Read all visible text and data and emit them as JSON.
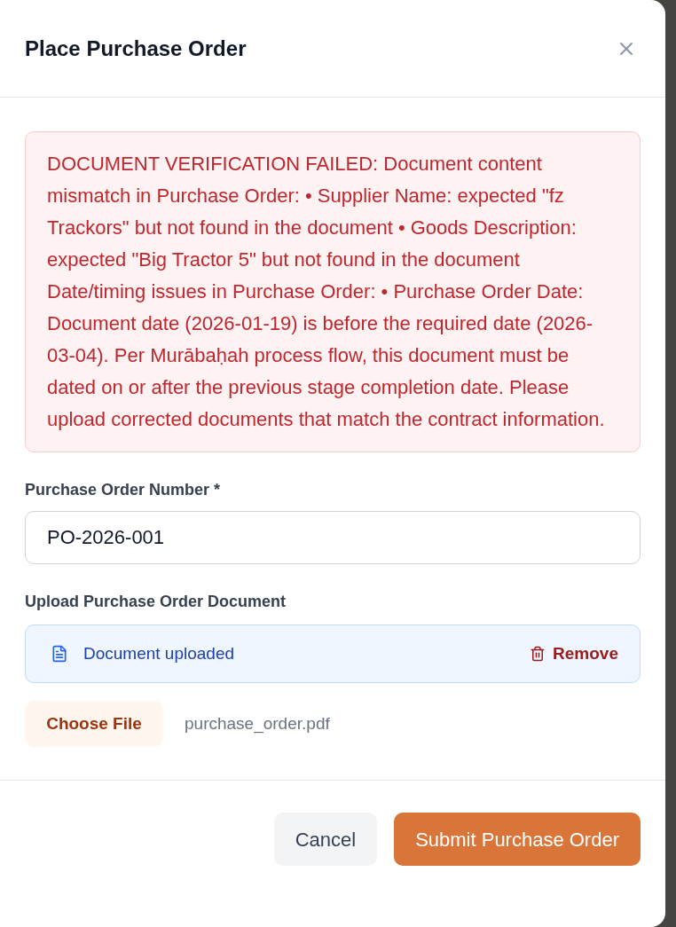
{
  "dialog": {
    "title": "Place Purchase Order"
  },
  "alert": {
    "kind": "error",
    "message": "DOCUMENT VERIFICATION FAILED: Document content mismatch in Purchase Order: • Supplier Name: expected \"fz Trackors\" but not found in the document • Goods Description: expected \"Big Tractor 5\" but not found in the document Date/timing issues in Purchase Order: • Purchase Order Date: Document date (2026-01-19) is before the required date (2026-03-04). Per Murābaḥah process flow, this document must be dated on or after the previous stage completion date. Please upload corrected documents that match the contract information."
  },
  "fields": [
    {
      "kind": "text",
      "label": "Purchase Order Number *",
      "value": "PO-2026-001"
    },
    {
      "kind": "upload",
      "label": "Upload Purchase Order Document",
      "status": "Document uploaded",
      "remove_label": "Remove",
      "choose_label": "Choose File",
      "file_name": "purchase_order.pdf"
    }
  ],
  "buttons": [
    {
      "kind": "secondary",
      "label": "Cancel"
    },
    {
      "kind": "primary",
      "label": "Submit Purchase Order"
    }
  ]
}
